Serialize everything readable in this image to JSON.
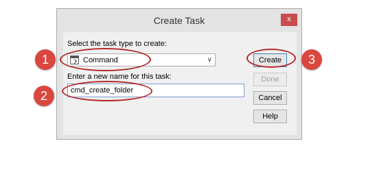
{
  "window": {
    "title": "Create Task",
    "close_label": "x"
  },
  "form": {
    "type_label": "Select the task type to create:",
    "type_value": "Command",
    "name_label": "Enter a new name for this task:",
    "name_value": "cmd_create_folder"
  },
  "buttons": {
    "create": "Create",
    "done": "Done",
    "cancel": "Cancel",
    "help": "Help"
  },
  "callouts": [
    "1",
    "2",
    "3"
  ],
  "colors": {
    "annotation_red": "#d9473f",
    "close_red": "#c94c4c"
  }
}
